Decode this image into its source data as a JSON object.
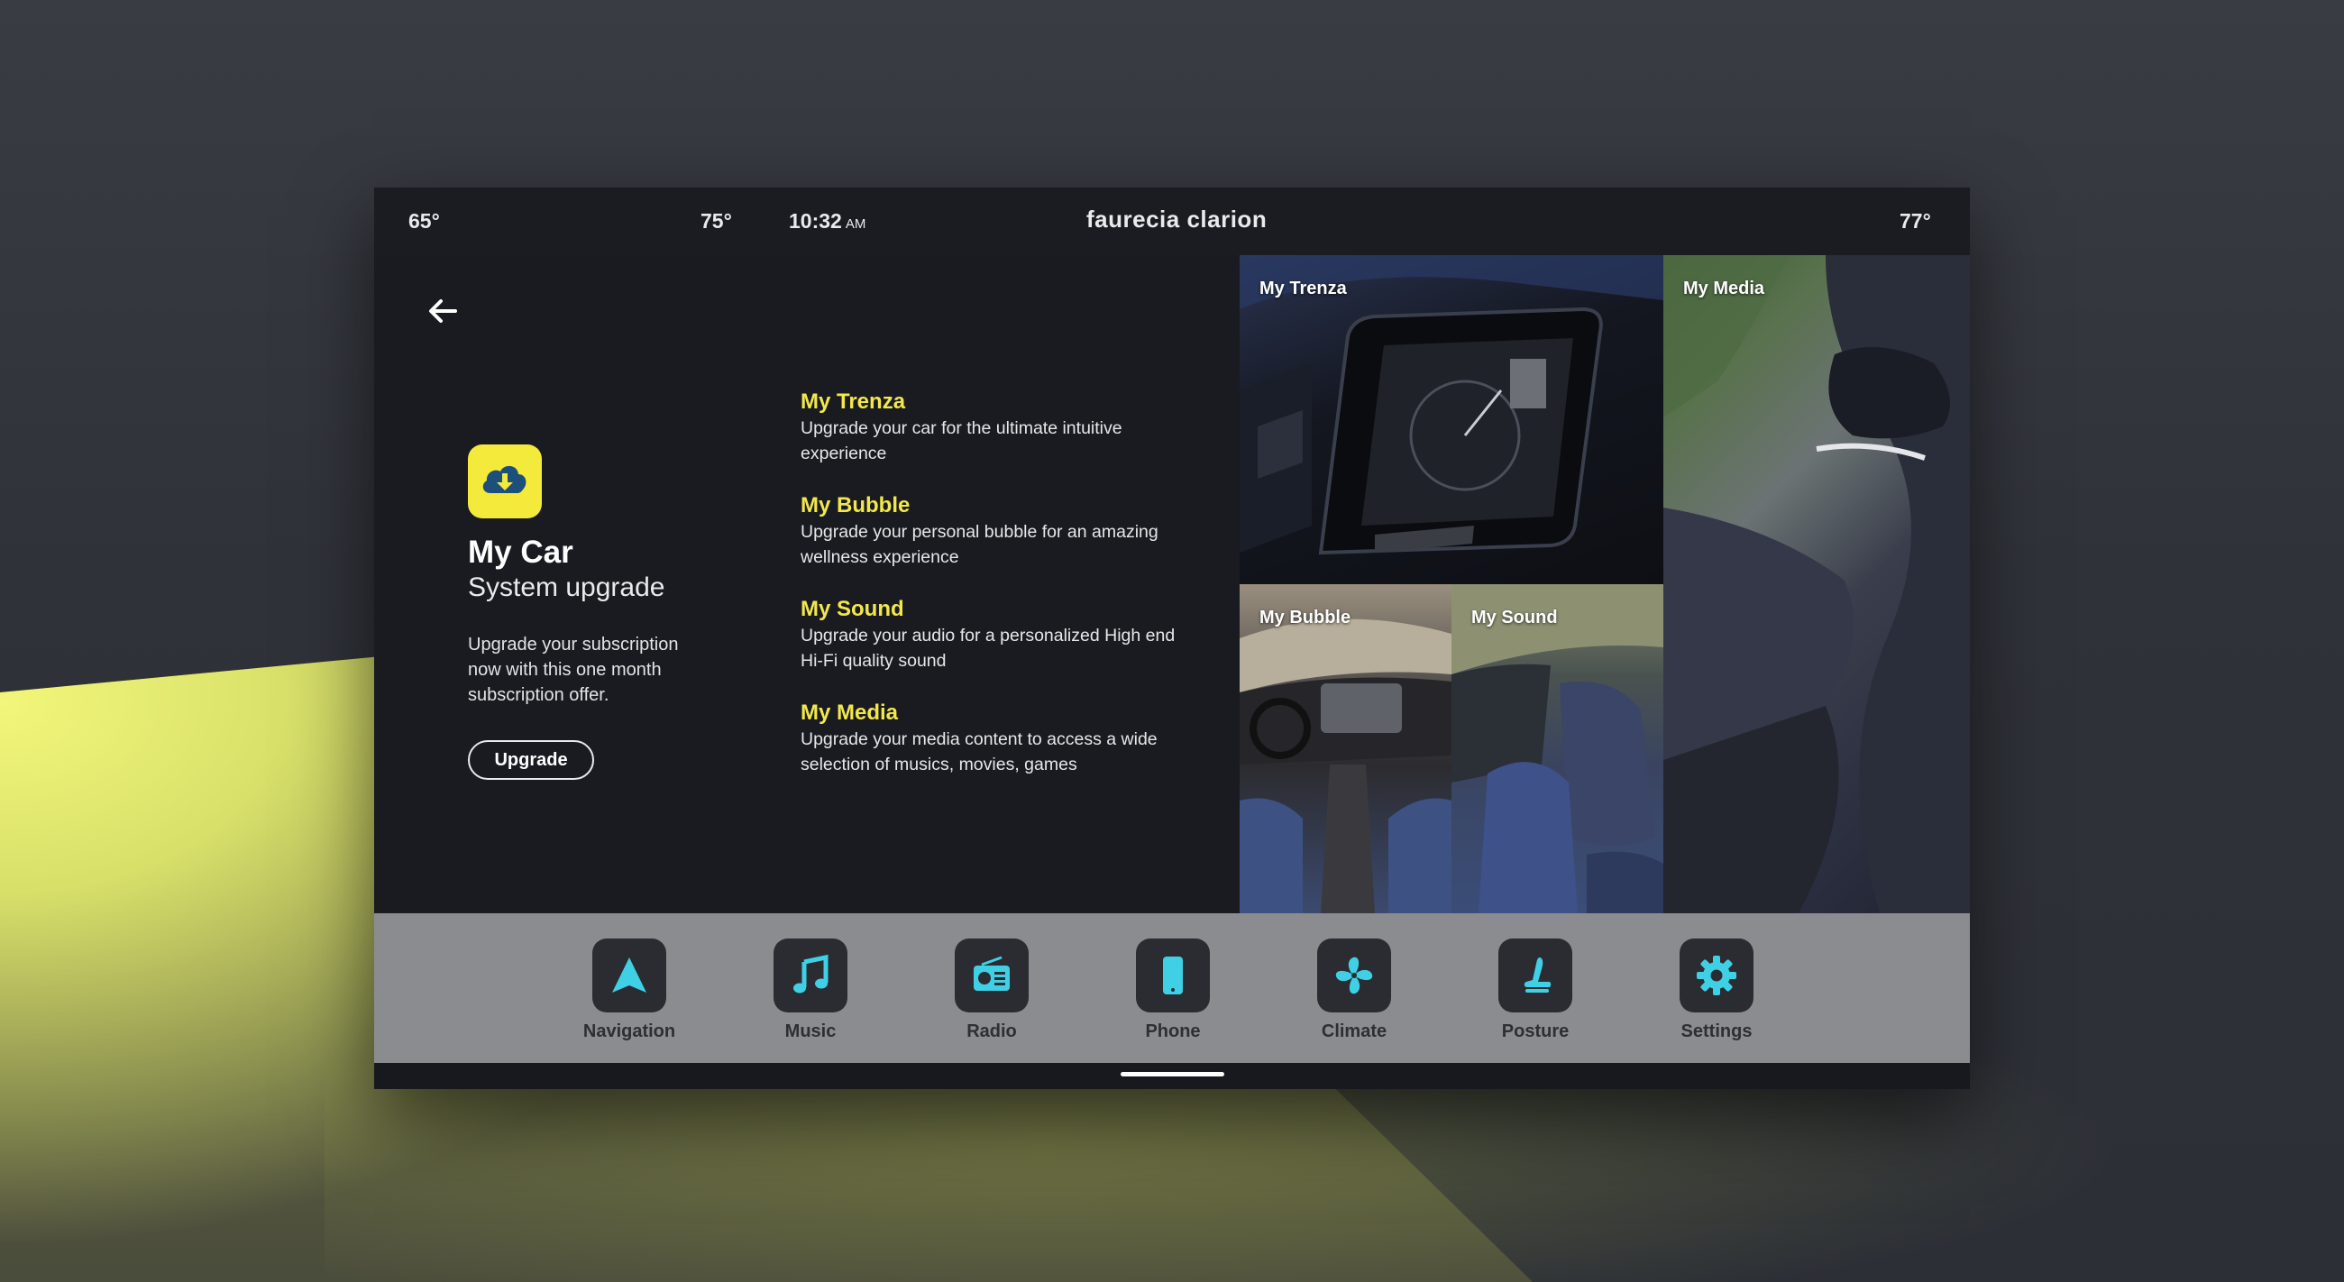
{
  "status_bar": {
    "temp_left": "65°",
    "temp_mid": "75°",
    "time": "10:32",
    "ampm": "AM",
    "brand": "faurecia clarion",
    "temp_right": "77°"
  },
  "main": {
    "back_icon": "arrow-left-icon",
    "app_icon": "cloud-download-icon",
    "title": "My Car",
    "subtitle": "System upgrade",
    "description": "Upgrade your subscription now with this one month subscription offer.",
    "upgrade_label": "Upgrade"
  },
  "features": [
    {
      "name": "My Trenza",
      "description": "Upgrade your car for the ultimate intuitive experience"
    },
    {
      "name": "My Bubble",
      "description": "Upgrade your personal bubble for an amazing wellness experience"
    },
    {
      "name": "My Sound",
      "description": "Upgrade your audio for a personalized High end Hi-Fi quality sound"
    },
    {
      "name": "My Media",
      "description": "Upgrade your media content to access a wide selection of musics, movies, games"
    }
  ],
  "tiles": {
    "trenza": "My Trenza",
    "media": "My Media",
    "bubble": "My Bubble",
    "sound": "My Sound"
  },
  "dock": [
    {
      "label": "Navigation",
      "icon": "navigation-arrow-icon"
    },
    {
      "label": "Music",
      "icon": "music-note-icon"
    },
    {
      "label": "Radio",
      "icon": "radio-icon"
    },
    {
      "label": "Phone",
      "icon": "phone-icon"
    },
    {
      "label": "Climate",
      "icon": "fan-icon"
    },
    {
      "label": "Posture",
      "icon": "seat-icon"
    },
    {
      "label": "Settings",
      "icon": "gear-icon"
    }
  ],
  "colors": {
    "accent_yellow": "#f2e84b",
    "icon_cyan": "#3fd0e6",
    "dock_bg": "#8b8c90",
    "screen_bg": "#191b20"
  }
}
